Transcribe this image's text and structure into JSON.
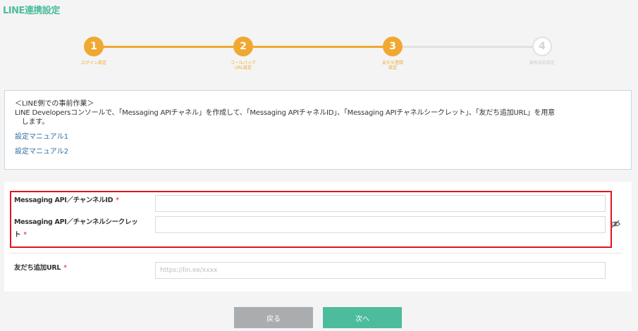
{
  "page": {
    "title": "LINE連携設定"
  },
  "stepper": {
    "steps": [
      {
        "number": "1",
        "label": "ログイン設定",
        "state": "done"
      },
      {
        "number": "2",
        "label": "コールバック\nURL設定",
        "state": "done"
      },
      {
        "number": "3",
        "label": "友だち登録\n設定",
        "state": "done"
      },
      {
        "number": "4",
        "label": "顧客項目設定",
        "state": "todo"
      }
    ],
    "colors": {
      "done": "#f0a830",
      "todo": "#e1e1e1"
    }
  },
  "notice": {
    "heading": "＜LINE側での事前作業＞",
    "body": "LINE Developersコンソールで、「Messaging APIチャネル」を作成して、「Messaging APIチャネルID」、「Messaging APIチャネルシークレット」、「友だち追加URL」を用意\n　します。",
    "links": [
      "設定マニュアル1",
      "設定マニュアル2"
    ]
  },
  "form": {
    "channel_id": {
      "label": "Messaging API／チャンネルID",
      "required": "*",
      "value": "",
      "placeholder": ""
    },
    "channel_secret": {
      "label": "Messaging API／チャンネルシークレッ\nト",
      "required": "*",
      "value": "",
      "placeholder": ""
    },
    "friend_url": {
      "label": "友だち追加URL",
      "required": "*",
      "value": "",
      "placeholder": "https://lin.ee/xxxx"
    }
  },
  "actions": {
    "back_label": "戻る",
    "next_label": "次へ"
  },
  "colors": {
    "accent": "#4dbc9d",
    "highlight": "#e0141e",
    "link": "#2f6ea6"
  }
}
